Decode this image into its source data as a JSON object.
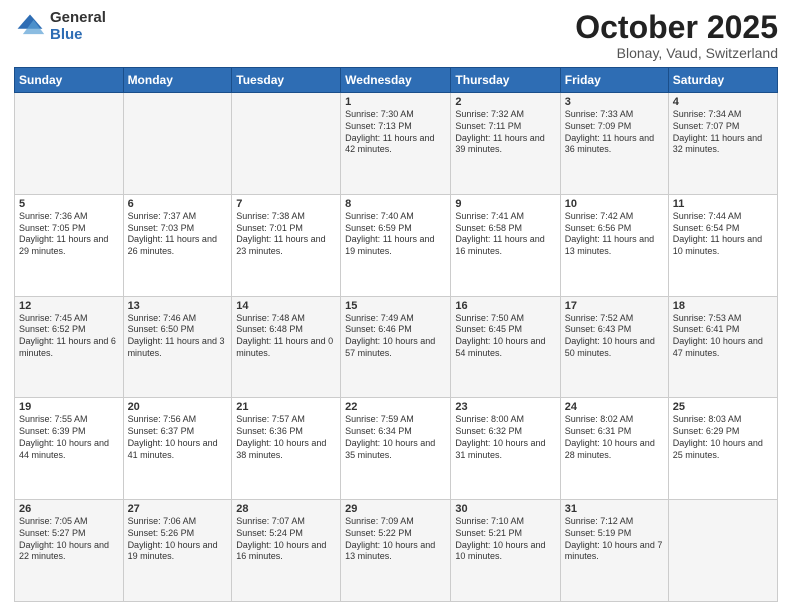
{
  "logo": {
    "general": "General",
    "blue": "Blue"
  },
  "title": "October 2025",
  "subtitle": "Blonay, Vaud, Switzerland",
  "weekdays": [
    "Sunday",
    "Monday",
    "Tuesday",
    "Wednesday",
    "Thursday",
    "Friday",
    "Saturday"
  ],
  "weeks": [
    [
      {
        "day": "",
        "sunrise": "",
        "sunset": "",
        "daylight": ""
      },
      {
        "day": "",
        "sunrise": "",
        "sunset": "",
        "daylight": ""
      },
      {
        "day": "",
        "sunrise": "",
        "sunset": "",
        "daylight": ""
      },
      {
        "day": "1",
        "sunrise": "Sunrise: 7:30 AM",
        "sunset": "Sunset: 7:13 PM",
        "daylight": "Daylight: 11 hours and 42 minutes."
      },
      {
        "day": "2",
        "sunrise": "Sunrise: 7:32 AM",
        "sunset": "Sunset: 7:11 PM",
        "daylight": "Daylight: 11 hours and 39 minutes."
      },
      {
        "day": "3",
        "sunrise": "Sunrise: 7:33 AM",
        "sunset": "Sunset: 7:09 PM",
        "daylight": "Daylight: 11 hours and 36 minutes."
      },
      {
        "day": "4",
        "sunrise": "Sunrise: 7:34 AM",
        "sunset": "Sunset: 7:07 PM",
        "daylight": "Daylight: 11 hours and 32 minutes."
      }
    ],
    [
      {
        "day": "5",
        "sunrise": "Sunrise: 7:36 AM",
        "sunset": "Sunset: 7:05 PM",
        "daylight": "Daylight: 11 hours and 29 minutes."
      },
      {
        "day": "6",
        "sunrise": "Sunrise: 7:37 AM",
        "sunset": "Sunset: 7:03 PM",
        "daylight": "Daylight: 11 hours and 26 minutes."
      },
      {
        "day": "7",
        "sunrise": "Sunrise: 7:38 AM",
        "sunset": "Sunset: 7:01 PM",
        "daylight": "Daylight: 11 hours and 23 minutes."
      },
      {
        "day": "8",
        "sunrise": "Sunrise: 7:40 AM",
        "sunset": "Sunset: 6:59 PM",
        "daylight": "Daylight: 11 hours and 19 minutes."
      },
      {
        "day": "9",
        "sunrise": "Sunrise: 7:41 AM",
        "sunset": "Sunset: 6:58 PM",
        "daylight": "Daylight: 11 hours and 16 minutes."
      },
      {
        "day": "10",
        "sunrise": "Sunrise: 7:42 AM",
        "sunset": "Sunset: 6:56 PM",
        "daylight": "Daylight: 11 hours and 13 minutes."
      },
      {
        "day": "11",
        "sunrise": "Sunrise: 7:44 AM",
        "sunset": "Sunset: 6:54 PM",
        "daylight": "Daylight: 11 hours and 10 minutes."
      }
    ],
    [
      {
        "day": "12",
        "sunrise": "Sunrise: 7:45 AM",
        "sunset": "Sunset: 6:52 PM",
        "daylight": "Daylight: 11 hours and 6 minutes."
      },
      {
        "day": "13",
        "sunrise": "Sunrise: 7:46 AM",
        "sunset": "Sunset: 6:50 PM",
        "daylight": "Daylight: 11 hours and 3 minutes."
      },
      {
        "day": "14",
        "sunrise": "Sunrise: 7:48 AM",
        "sunset": "Sunset: 6:48 PM",
        "daylight": "Daylight: 11 hours and 0 minutes."
      },
      {
        "day": "15",
        "sunrise": "Sunrise: 7:49 AM",
        "sunset": "Sunset: 6:46 PM",
        "daylight": "Daylight: 10 hours and 57 minutes."
      },
      {
        "day": "16",
        "sunrise": "Sunrise: 7:50 AM",
        "sunset": "Sunset: 6:45 PM",
        "daylight": "Daylight: 10 hours and 54 minutes."
      },
      {
        "day": "17",
        "sunrise": "Sunrise: 7:52 AM",
        "sunset": "Sunset: 6:43 PM",
        "daylight": "Daylight: 10 hours and 50 minutes."
      },
      {
        "day": "18",
        "sunrise": "Sunrise: 7:53 AM",
        "sunset": "Sunset: 6:41 PM",
        "daylight": "Daylight: 10 hours and 47 minutes."
      }
    ],
    [
      {
        "day": "19",
        "sunrise": "Sunrise: 7:55 AM",
        "sunset": "Sunset: 6:39 PM",
        "daylight": "Daylight: 10 hours and 44 minutes."
      },
      {
        "day": "20",
        "sunrise": "Sunrise: 7:56 AM",
        "sunset": "Sunset: 6:37 PM",
        "daylight": "Daylight: 10 hours and 41 minutes."
      },
      {
        "day": "21",
        "sunrise": "Sunrise: 7:57 AM",
        "sunset": "Sunset: 6:36 PM",
        "daylight": "Daylight: 10 hours and 38 minutes."
      },
      {
        "day": "22",
        "sunrise": "Sunrise: 7:59 AM",
        "sunset": "Sunset: 6:34 PM",
        "daylight": "Daylight: 10 hours and 35 minutes."
      },
      {
        "day": "23",
        "sunrise": "Sunrise: 8:00 AM",
        "sunset": "Sunset: 6:32 PM",
        "daylight": "Daylight: 10 hours and 31 minutes."
      },
      {
        "day": "24",
        "sunrise": "Sunrise: 8:02 AM",
        "sunset": "Sunset: 6:31 PM",
        "daylight": "Daylight: 10 hours and 28 minutes."
      },
      {
        "day": "25",
        "sunrise": "Sunrise: 8:03 AM",
        "sunset": "Sunset: 6:29 PM",
        "daylight": "Daylight: 10 hours and 25 minutes."
      }
    ],
    [
      {
        "day": "26",
        "sunrise": "Sunrise: 7:05 AM",
        "sunset": "Sunset: 5:27 PM",
        "daylight": "Daylight: 10 hours and 22 minutes."
      },
      {
        "day": "27",
        "sunrise": "Sunrise: 7:06 AM",
        "sunset": "Sunset: 5:26 PM",
        "daylight": "Daylight: 10 hours and 19 minutes."
      },
      {
        "day": "28",
        "sunrise": "Sunrise: 7:07 AM",
        "sunset": "Sunset: 5:24 PM",
        "daylight": "Daylight: 10 hours and 16 minutes."
      },
      {
        "day": "29",
        "sunrise": "Sunrise: 7:09 AM",
        "sunset": "Sunset: 5:22 PM",
        "daylight": "Daylight: 10 hours and 13 minutes."
      },
      {
        "day": "30",
        "sunrise": "Sunrise: 7:10 AM",
        "sunset": "Sunset: 5:21 PM",
        "daylight": "Daylight: 10 hours and 10 minutes."
      },
      {
        "day": "31",
        "sunrise": "Sunrise: 7:12 AM",
        "sunset": "Sunset: 5:19 PM",
        "daylight": "Daylight: 10 hours and 7 minutes."
      },
      {
        "day": "",
        "sunrise": "",
        "sunset": "",
        "daylight": ""
      }
    ]
  ]
}
